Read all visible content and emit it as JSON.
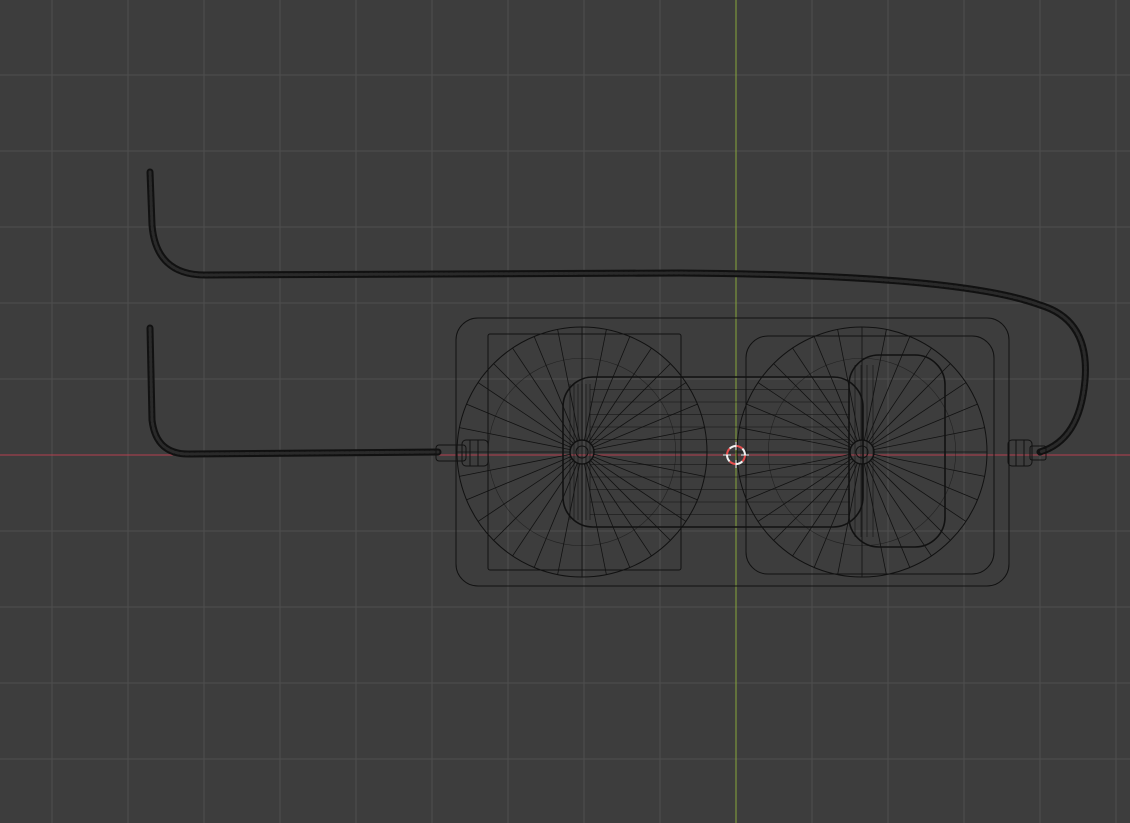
{
  "viewport": {
    "view": "top-orthographic",
    "shading": "wireframe",
    "grid": true,
    "colors": {
      "background": "#3d3d3d",
      "grid_line": "#4f4f4f",
      "x_axis": "#b5404f",
      "y_axis": "#88a63a",
      "wire": "#111111",
      "cursor_red": "#e64d4d",
      "cursor_white": "#f2f2f2"
    }
  },
  "scene_objects": [
    {
      "name": "cable-left",
      "type": "curve-mesh"
    },
    {
      "name": "cable-right",
      "type": "curve-mesh"
    },
    {
      "name": "left-connector",
      "type": "mesh"
    },
    {
      "name": "right-connector",
      "type": "mesh"
    },
    {
      "name": "outer-housing",
      "type": "mesh"
    },
    {
      "name": "left-cell-housing",
      "type": "mesh"
    },
    {
      "name": "right-cell-housing",
      "type": "mesh"
    },
    {
      "name": "left-spoke-disc",
      "type": "mesh"
    },
    {
      "name": "right-spoke-disc",
      "type": "mesh"
    },
    {
      "name": "central-capsule",
      "type": "mesh"
    },
    {
      "name": "right-end-cap",
      "type": "mesh"
    }
  ],
  "cursor": {
    "icon": "3d-cursor-icon"
  }
}
